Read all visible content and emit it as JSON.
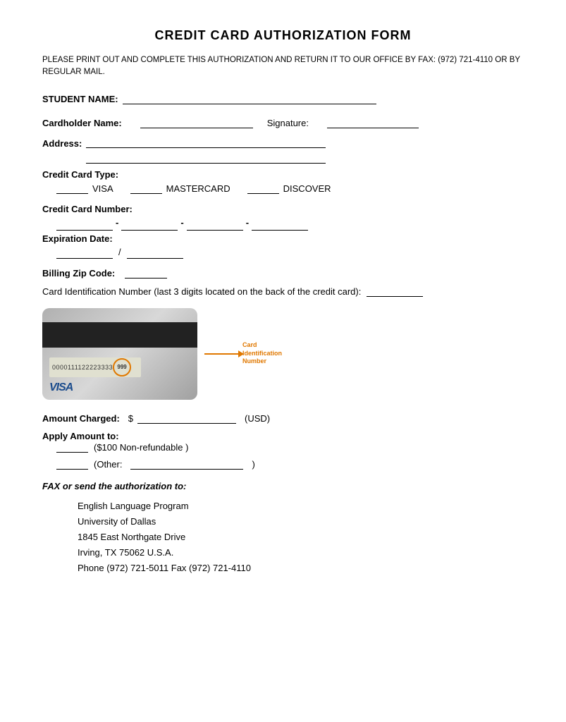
{
  "page": {
    "title": "CREDIT CARD AUTHORIZATION FORM",
    "instructions": "PLEASE PRINT OUT AND COMPLETE THIS AUTHORIZATION AND RETURN IT TO OUR OFFICE BY FAX: (972) 721-4110 OR BY REGULAR MAIL.",
    "fields": {
      "student_name_label": "STUDENT NAME:",
      "cardholder_label": "Cardholder Name:",
      "signature_label": "Signature:",
      "address_label": "Address:",
      "cc_type_label": "Credit Card Type:",
      "cc_type_visa": "VISA",
      "cc_type_mastercard": "MASTERCARD",
      "cc_type_discover": "DISCOVER",
      "cc_number_label": "Credit Card Number:",
      "expiration_label": "Expiration Date:",
      "billing_zip_label": "Billing Zip Code:",
      "card_id_label": "Card Identification Number (last 3 digits located on the back of the credit card):",
      "amount_label": "Amount Charged:",
      "amount_currency_prefix": "$",
      "amount_currency_suffix": "(USD)",
      "apply_label": "Apply Amount to:",
      "apply_option1": "($100 Non-refundable )",
      "apply_option2_prefix": "(Other:",
      "apply_option2_suffix": ")",
      "fax_title": "FAX or send the authorization to:",
      "org_name": "English Language Program",
      "org_university": "University of Dallas",
      "org_address": "1845 East Northgate Drive",
      "org_city": "Irving, TX 75062     U.S.A.",
      "org_phone_fax": "Phone (972) 721-5011   Fax (972) 721-4110"
    },
    "card_visual": {
      "number_display": "0000111122223333",
      "cvv": "999",
      "id_label_line1": "Card",
      "id_label_line2": "Identification",
      "id_label_line3": "Number",
      "brand": "VISA"
    }
  }
}
